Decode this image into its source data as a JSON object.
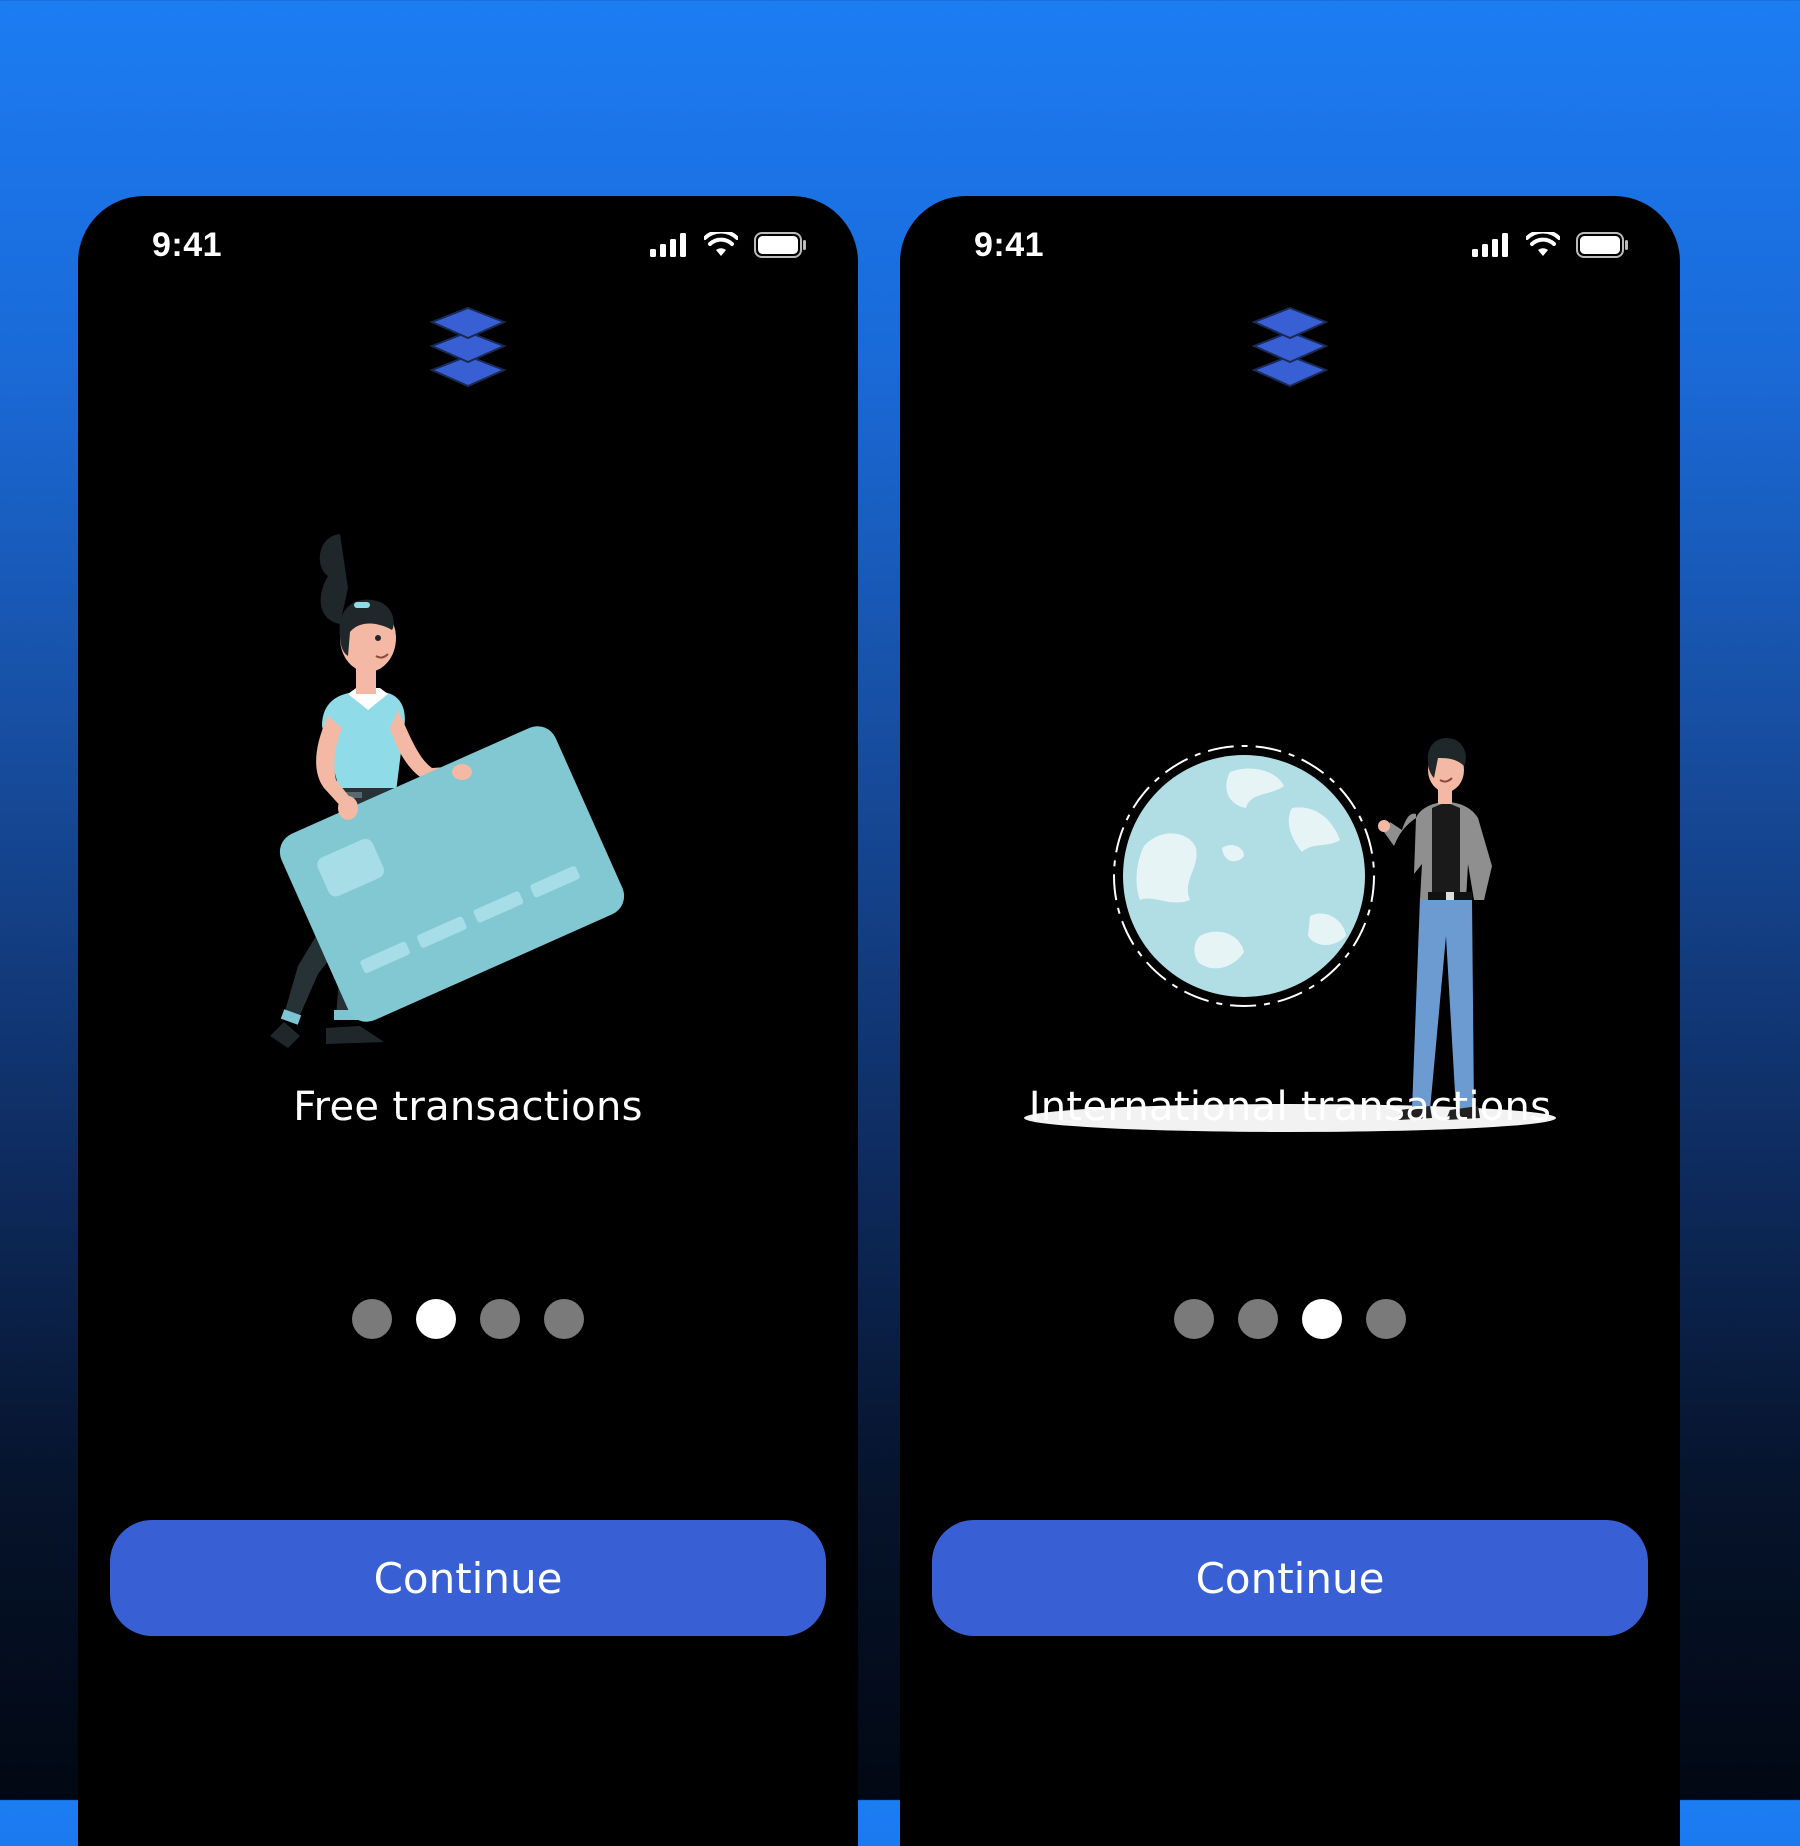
{
  "accent_color": "#3860d4",
  "screens": [
    {
      "status": {
        "time": "9:41"
      },
      "illustration": "woman-with-credit-card",
      "title": "Free transactions",
      "pagination": {
        "count": 4,
        "active": 2
      },
      "continue_label": "Continue"
    },
    {
      "status": {
        "time": "9:41"
      },
      "illustration": "man-with-globe",
      "title": "International transactions",
      "pagination": {
        "count": 4,
        "active": 3
      },
      "continue_label": "Continue"
    }
  ]
}
